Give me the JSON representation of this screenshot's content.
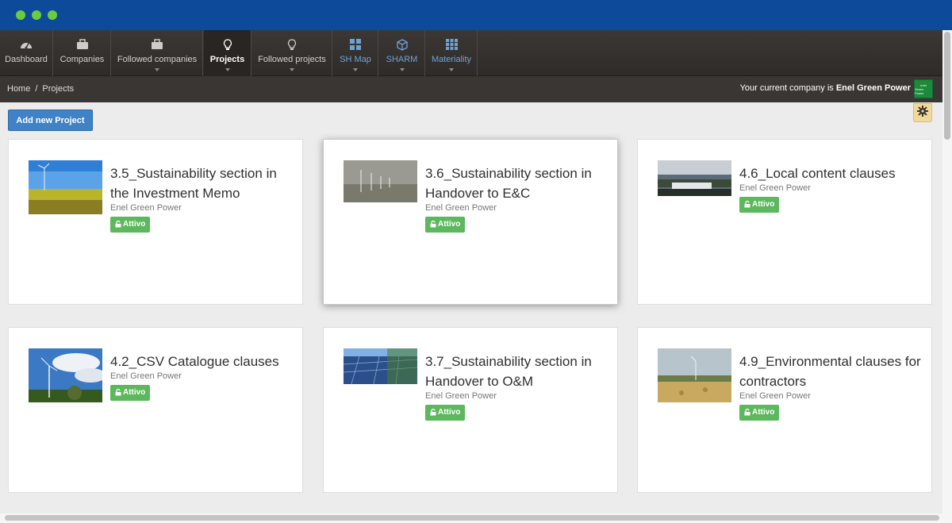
{
  "nav": {
    "items": [
      {
        "label": "Dashboard",
        "icon": "dashboard-gauge-icon"
      },
      {
        "label": "Companies",
        "icon": "briefcase-icon"
      },
      {
        "label": "Followed companies",
        "icon": "briefcase-icon"
      },
      {
        "label": "Projects",
        "icon": "lightbulb-icon"
      },
      {
        "label": "Followed projects",
        "icon": "lightbulb-icon"
      },
      {
        "label": "SH Map",
        "icon": "grid-icon"
      },
      {
        "label": "SHARM",
        "icon": "cube-icon"
      },
      {
        "label": "Materiality",
        "icon": "grid-dots-icon"
      }
    ]
  },
  "breadcrumb": {
    "home": "Home",
    "separator": "/",
    "current": "Projects"
  },
  "company": {
    "prefix": "Your current company is",
    "name": "Enel Green Power",
    "logo_text_1": "enel",
    "logo_text_2": "Green Power"
  },
  "toolbar": {
    "add_label": "Add new Project"
  },
  "colors": {
    "accent": "#3f82c6",
    "badge": "#5cb85c",
    "titlebar": "#0d4b9a"
  },
  "projects": [
    {
      "title": "3.5_Sustainability section in the Investment Memo",
      "company": "Enel Green Power",
      "status": "Attivo"
    },
    {
      "title": "3.6_Sustainability section in Handover to E&C",
      "company": "Enel Green Power",
      "status": "Attivo"
    },
    {
      "title": "4.6_Local content clauses",
      "company": "Enel Green Power",
      "status": "Attivo"
    },
    {
      "title": "4.2_CSV Catalogue clauses",
      "company": "Enel Green Power",
      "status": "Attivo"
    },
    {
      "title": "3.7_Sustainability section in Handover to O&M",
      "company": "Enel Green Power",
      "status": "Attivo"
    },
    {
      "title": "4.9_Environmental clauses for contractors",
      "company": "Enel Green Power",
      "status": "Attivo"
    }
  ]
}
